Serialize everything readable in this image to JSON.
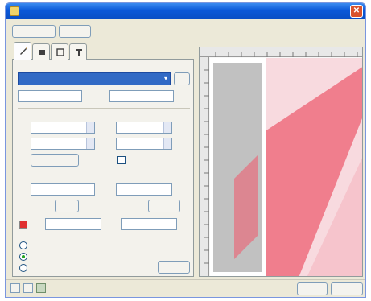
{
  "window": {
    "title": "",
    "close_glyph": "✕",
    "icon": "app-icon"
  },
  "toolbar": {
    "top_button_label": "",
    "top_button2_label": ""
  },
  "tabs": [
    {
      "icon": "pen-tool-icon"
    },
    {
      "icon": "layers-icon"
    },
    {
      "icon": "crop-icon"
    },
    {
      "icon": "text-tool-icon"
    }
  ],
  "panel": {
    "section1_label": "",
    "dropdown_value": "",
    "dropdown_arrow": "▾",
    "row1_left_value": "",
    "row1_right_value": "",
    "section2_label": "",
    "width_label": "",
    "width_value": "",
    "height_label": "",
    "height_value": "",
    "pos_x_label": "",
    "pos_x_value": "",
    "pos_y_label": "",
    "pos_y_value": "",
    "lock_button_label": "",
    "keep_ratio_label": "",
    "section3_label": "",
    "left_field_value": "",
    "right_field_value": "",
    "apply_left_label": "",
    "apply_right_label": "",
    "angle_label": "",
    "angle_value": "",
    "opacity_label": "",
    "opacity_value": "",
    "option1_label": "",
    "option2_label": "",
    "option3_label": "",
    "reset_button_label": ""
  },
  "statusbar": {
    "item1": "",
    "item2": "",
    "ok_label": "",
    "cancel_label": ""
  },
  "colors": {
    "accent": "#316ac5",
    "title_bar": "#0b58d8",
    "art_red": "#ee5f72",
    "art_gray": "#8e8e8e",
    "swatch_red": "#e03030"
  }
}
